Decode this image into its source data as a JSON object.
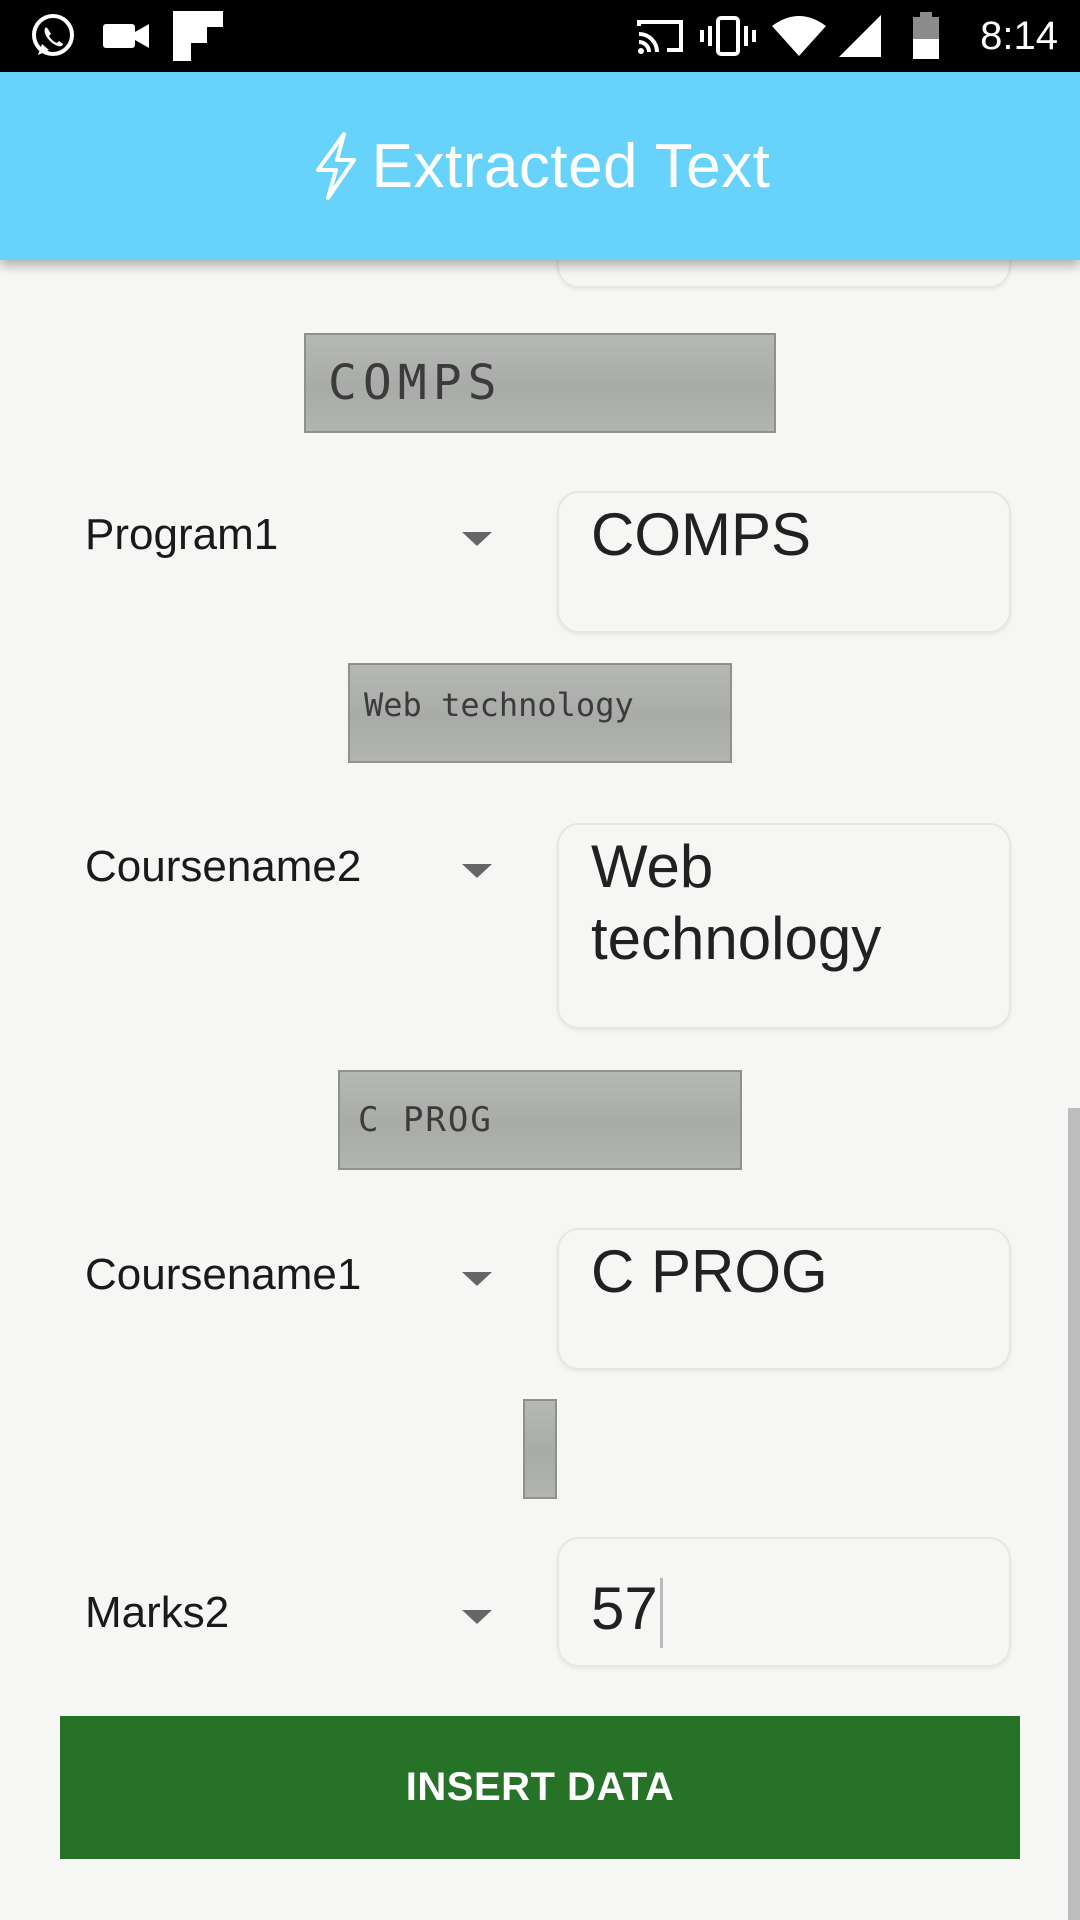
{
  "status_bar": {
    "time": "8:14",
    "icons": [
      "whatsapp-icon",
      "video-camera-icon",
      "flipboard-icon",
      "cast-icon",
      "vibrate-icon",
      "wifi-icon",
      "cell-signal-icon",
      "battery-icon"
    ]
  },
  "app_bar": {
    "icon": "flash-icon",
    "title": "Extracted Text"
  },
  "rows": [
    {
      "snippet_text": "COMPS",
      "label": "Program1",
      "value": "COMPS"
    },
    {
      "snippet_text": "Web technology",
      "label": "Coursename2",
      "value": "Web technology"
    },
    {
      "snippet_text": "C PROG",
      "label": "Coursename1",
      "value": "C PROG"
    },
    {
      "snippet_text": "",
      "label": "Marks2",
      "value": "57"
    }
  ],
  "insert_button": {
    "label": "INSERT DATA",
    "color": "#267327"
  },
  "colors": {
    "app_bar": "#67d3fb",
    "background": "#f6f7f5"
  }
}
